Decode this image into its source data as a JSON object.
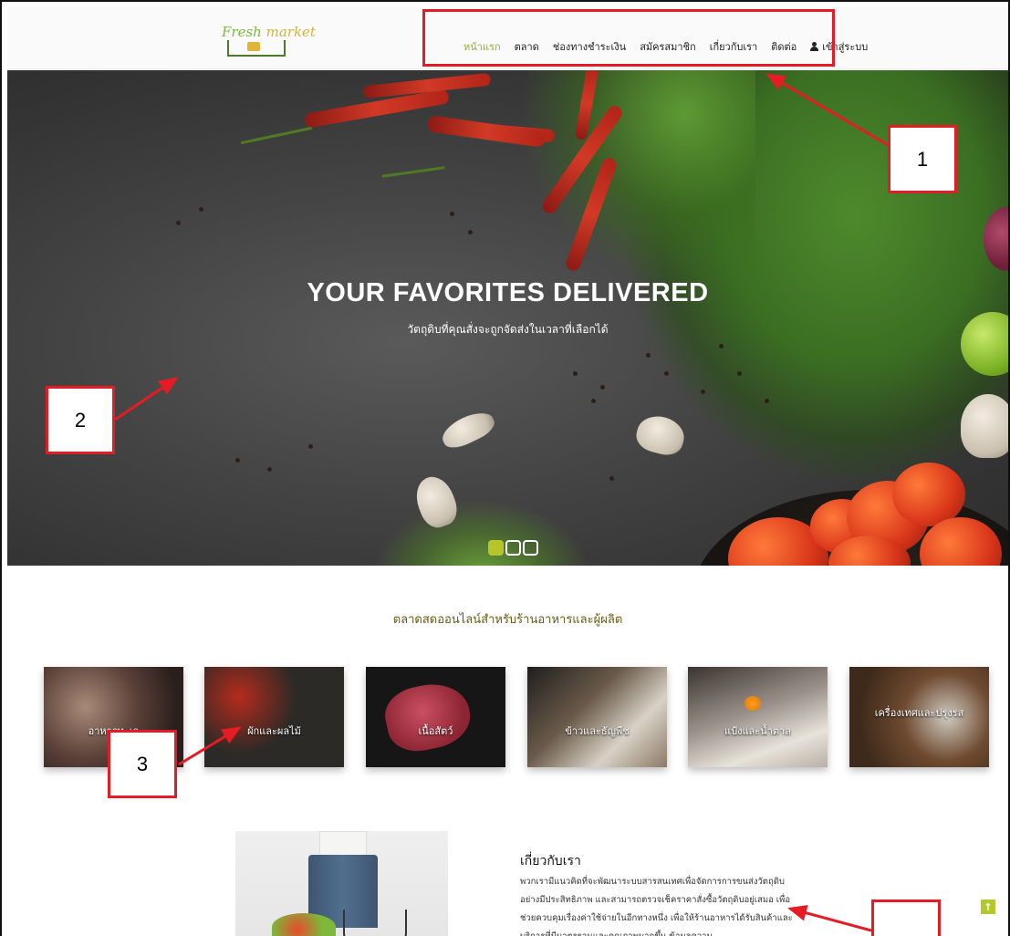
{
  "header": {
    "logo_text_1": "Fresh",
    "logo_text_2": "market",
    "nav": [
      {
        "label": "หน้าแรก",
        "active": true
      },
      {
        "label": "ตลาด"
      },
      {
        "label": "ช่องทางชำระเงิน"
      },
      {
        "label": "สมัครสมาชิก"
      },
      {
        "label": "เกี่ยวกับเรา"
      },
      {
        "label": "ติดต่อ"
      },
      {
        "label": "เข้าสู่ระบบ",
        "icon": "user-icon"
      }
    ]
  },
  "hero": {
    "title": "YOUR FAVORITES DELIVERED",
    "subtitle": "วัตถุดิบที่คุณสั่งจะถูกจัดส่งในเวลาที่เลือกได้",
    "slides_count": 3,
    "active_slide": 1
  },
  "section": {
    "title": "ตลาดสดออนไลน์สำหรับร้านอาหารและผู้ผลิต"
  },
  "categories": [
    {
      "label": "อาหารทะเล"
    },
    {
      "label": "ผักและผลไม้"
    },
    {
      "label": "เนื้อสัตว์"
    },
    {
      "label": "ข้าวและธัญพืช"
    },
    {
      "label": "แป้งและน้ำตาล"
    },
    {
      "label": "เครื่องเทศและปรุงรส"
    }
  ],
  "about": {
    "title": "เกี่ยวกับเรา",
    "text": "พวกเรามีแนวคิดที่จะพัฒนาระบบสารสนเทศเพื่อจัดการการขนส่งวัตถุดิบอย่างมีประสิทธิภาพ และสามารถตรวจเช็คราคาสั่งซื้อวัตถุดิบอยู่เสมอ เพื่อช่วยควบคุมเรื่องค่าใช้จ่ายในอีกทางหนึ่ง เพื่อให้ร้านอาหารได้รับสินค้าและบริการที่มีมาตรฐานและคุณภาพมากขึ้น ข้อมูลความ"
  },
  "callouts": [
    "1",
    "2",
    "3"
  ],
  "colors": {
    "accent": "#8ab33b",
    "callout_red": "#e51c23",
    "dot_active": "#b6c62a",
    "section_title": "#6a5a10"
  },
  "to_top": "↑"
}
